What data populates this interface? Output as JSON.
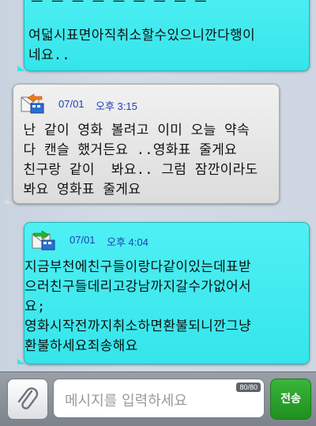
{
  "messages": [
    {
      "type": "received",
      "text": "여덟시표면아직취소할수있으니깐다행이\n네요.."
    },
    {
      "type": "sent",
      "date": "07/01",
      "time": "오후 3:15",
      "text": " 난 같이 영화 볼려고 이미 오늘 약속\n 다 캔슬 했거든요 ..영화표 줄게요\n 친구랑 같이  봐요.. 그럼 잠깐이라도\n 봐요 영화표 줄게요"
    },
    {
      "type": "received",
      "date": "07/01",
      "time": "오후 4:04",
      "text": "지금부천에친구들이랑다같이있는데표받\n으러친구들데리고강남까지갈수가없어서\n요;\n영화시작전까지취소하면환불되니깐그냥\n환불하세요죄송해요"
    }
  ],
  "composer": {
    "placeholder": "메시지를 입력하세요",
    "counter": "80/80",
    "send_label": "전송",
    "attach_icon": "paperclip-icon"
  },
  "colors": {
    "received_bubble": "#3fe9ee",
    "sent_bubble": "#e6e6e6",
    "meta_text": "#1f3fb5",
    "send_button": "#2a9f2a"
  }
}
